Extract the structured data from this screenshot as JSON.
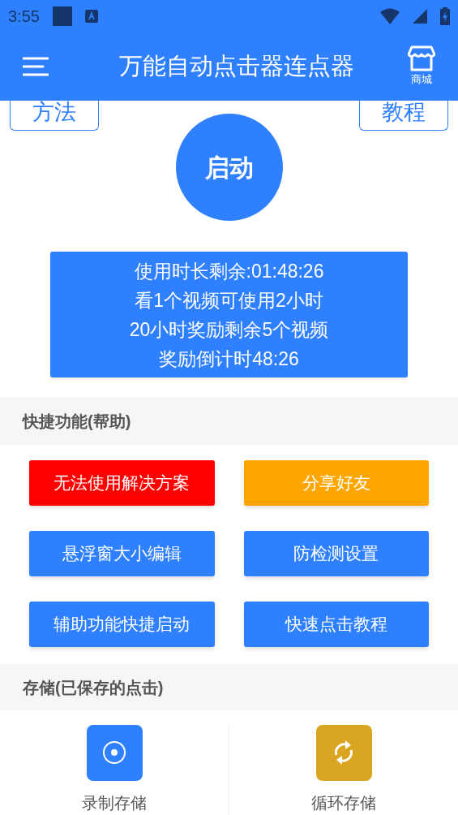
{
  "status_bar": {
    "time": "3:55"
  },
  "app_bar": {
    "title": "万能自动点击器连点器",
    "store_label": "商城"
  },
  "top_buttons": [
    "方法",
    "教程"
  ],
  "start_button": "启动",
  "info_lines": [
    "使用时长剩余:01:48:26",
    "看1个视频可使用2小时",
    "20小时奖励剩余5个视频",
    "奖励倒计时48:26"
  ],
  "quick_section": {
    "title": "快捷功能(帮助)",
    "buttons": [
      {
        "label": "无法使用解决方案",
        "color": "#ff0000"
      },
      {
        "label": "分享好友",
        "color": "#ffa500"
      },
      {
        "label": "悬浮窗大小编辑",
        "color": "#2f80ff"
      },
      {
        "label": "防检测设置",
        "color": "#2f80ff"
      },
      {
        "label": "辅助功能快捷启动",
        "color": "#2f80ff"
      },
      {
        "label": "快速点击教程",
        "color": "#2f80ff"
      }
    ]
  },
  "storage_section": {
    "title": "存储(已保存的点击)",
    "items": [
      {
        "label": "录制存储",
        "kind": "record",
        "color": "#2f80ff"
      },
      {
        "label": "循环存储",
        "kind": "loop",
        "color": "#daa520"
      }
    ]
  }
}
